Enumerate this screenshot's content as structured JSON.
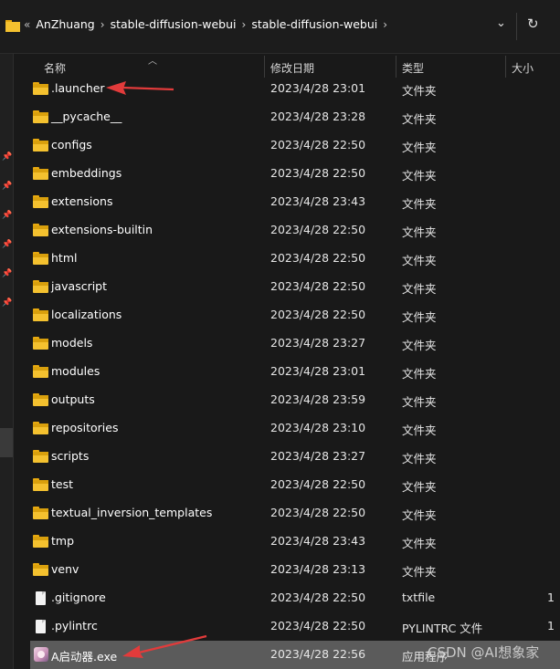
{
  "address_bar": {
    "overflow": "«",
    "crumbs": [
      "AnZhuang",
      "stable-diffusion-webui",
      "stable-diffusion-webui"
    ],
    "separator": "›",
    "dropdown_glyph": "⌄",
    "refresh_glyph": "↻"
  },
  "columns": {
    "name": "名称",
    "date": "修改日期",
    "type": "类型",
    "size": "大小"
  },
  "rows": [
    {
      "name": ".launcher",
      "date": "2023/4/28 23:01",
      "type": "文件夹",
      "size": "",
      "icon": "folder-icon"
    },
    {
      "name": "__pycache__",
      "date": "2023/4/28 23:28",
      "type": "文件夹",
      "size": "",
      "icon": "folder-icon"
    },
    {
      "name": "configs",
      "date": "2023/4/28 22:50",
      "type": "文件夹",
      "size": "",
      "icon": "folder-icon"
    },
    {
      "name": "embeddings",
      "date": "2023/4/28 22:50",
      "type": "文件夹",
      "size": "",
      "icon": "folder-icon"
    },
    {
      "name": "extensions",
      "date": "2023/4/28 23:43",
      "type": "文件夹",
      "size": "",
      "icon": "folder-icon"
    },
    {
      "name": "extensions-builtin",
      "date": "2023/4/28 22:50",
      "type": "文件夹",
      "size": "",
      "icon": "folder-icon"
    },
    {
      "name": "html",
      "date": "2023/4/28 22:50",
      "type": "文件夹",
      "size": "",
      "icon": "folder-icon"
    },
    {
      "name": "javascript",
      "date": "2023/4/28 22:50",
      "type": "文件夹",
      "size": "",
      "icon": "folder-icon"
    },
    {
      "name": "localizations",
      "date": "2023/4/28 22:50",
      "type": "文件夹",
      "size": "",
      "icon": "folder-icon"
    },
    {
      "name": "models",
      "date": "2023/4/28 23:27",
      "type": "文件夹",
      "size": "",
      "icon": "folder-icon"
    },
    {
      "name": "modules",
      "date": "2023/4/28 23:01",
      "type": "文件夹",
      "size": "",
      "icon": "folder-icon"
    },
    {
      "name": "outputs",
      "date": "2023/4/28 23:59",
      "type": "文件夹",
      "size": "",
      "icon": "folder-icon"
    },
    {
      "name": "repositories",
      "date": "2023/4/28 23:10",
      "type": "文件夹",
      "size": "",
      "icon": "folder-icon"
    },
    {
      "name": "scripts",
      "date": "2023/4/28 23:27",
      "type": "文件夹",
      "size": "",
      "icon": "folder-icon"
    },
    {
      "name": "test",
      "date": "2023/4/28 22:50",
      "type": "文件夹",
      "size": "",
      "icon": "folder-icon"
    },
    {
      "name": "textual_inversion_templates",
      "date": "2023/4/28 22:50",
      "type": "文件夹",
      "size": "",
      "icon": "folder-icon"
    },
    {
      "name": "tmp",
      "date": "2023/4/28 23:43",
      "type": "文件夹",
      "size": "",
      "icon": "folder-icon"
    },
    {
      "name": "venv",
      "date": "2023/4/28 23:13",
      "type": "文件夹",
      "size": "",
      "icon": "folder-icon"
    },
    {
      "name": ".gitignore",
      "date": "2023/4/28 22:50",
      "type": "txtfile",
      "size": "1",
      "icon": "file-icon"
    },
    {
      "name": ".pylintrc",
      "date": "2023/4/28 22:50",
      "type": "PYLINTRC 文件",
      "size": "1",
      "icon": "file-icon"
    },
    {
      "name": "A启动器.exe",
      "date": "2023/4/28 22:56",
      "type": "应用程序",
      "size": "",
      "icon": "app-icon",
      "selected": true
    }
  ],
  "watermark": "CSDN @AI想象家",
  "colors": {
    "background": "#191919",
    "folder": "#f4c12f",
    "selected_row": "#5b5b5b",
    "annotation_arrow": "#e23b3b"
  }
}
